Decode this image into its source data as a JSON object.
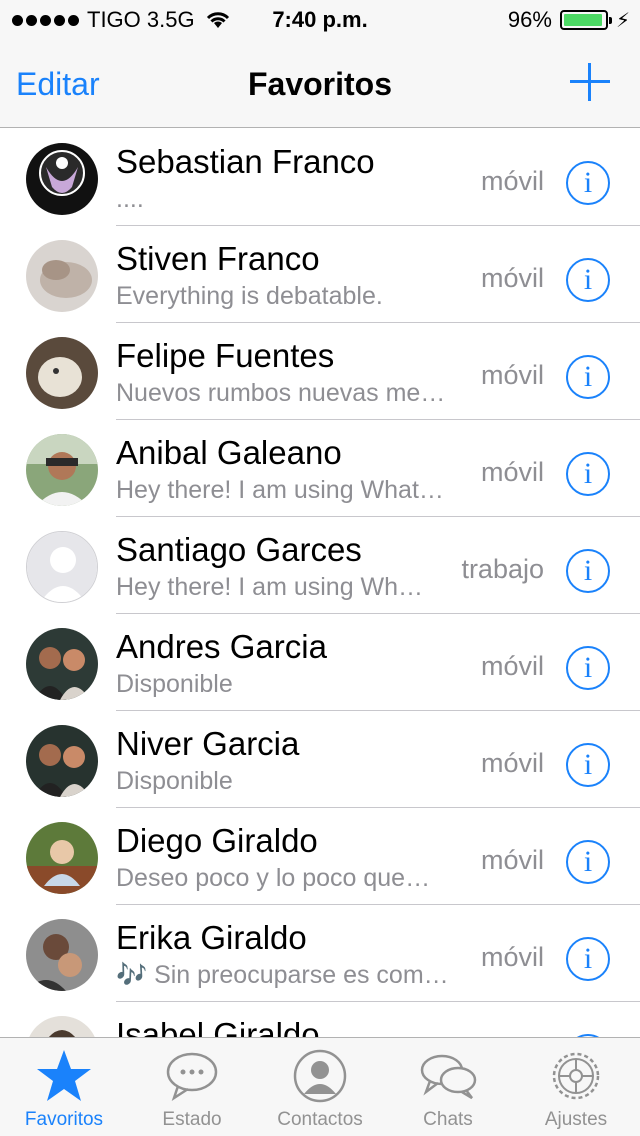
{
  "status_bar": {
    "carrier": "TIGO 3.5G",
    "time": "7:40 p.m.",
    "battery": "96%",
    "battery_level": 0.96
  },
  "nav": {
    "edit_label": "Editar",
    "title": "Favoritos"
  },
  "contacts": [
    {
      "name": "Sebastian Franco",
      "status": "....",
      "type": "móvil"
    },
    {
      "name": "Stiven Franco",
      "status": "Everything is debatable.",
      "type": "móvil"
    },
    {
      "name": "Felipe Fuentes",
      "status": "Nuevos rumbos nuevas me…",
      "type": "móvil"
    },
    {
      "name": "Anibal Galeano",
      "status": "Hey there! I am using What…",
      "type": "móvil"
    },
    {
      "name": "Santiago Garces",
      "status": "Hey there! I am using Wh…",
      "type": "trabajo"
    },
    {
      "name": "Andres Garcia",
      "status": "Disponible",
      "type": "móvil"
    },
    {
      "name": "Niver Garcia",
      "status": "Disponible",
      "type": "móvil"
    },
    {
      "name": "Diego Giraldo",
      "status": "Deseo poco y lo poco que…",
      "type": "móvil"
    },
    {
      "name": "Erika Giraldo",
      "status": "🎶 Sin preocuparse es com…",
      "type": "móvil"
    },
    {
      "name": "Isabel Giraldo",
      "status": "",
      "type": ""
    }
  ],
  "tabs": [
    {
      "label": "Favoritos",
      "icon": "star-icon",
      "active": true
    },
    {
      "label": "Estado",
      "icon": "speech-bubble-icon",
      "active": false
    },
    {
      "label": "Contactos",
      "icon": "contact-icon",
      "active": false
    },
    {
      "label": "Chats",
      "icon": "chats-icon",
      "active": false
    },
    {
      "label": "Ajustes",
      "icon": "gear-icon",
      "active": false
    }
  ],
  "colors": {
    "accent": "#1a82fb",
    "battery": "#4cd964",
    "secondary_text": "#8e8e93"
  }
}
